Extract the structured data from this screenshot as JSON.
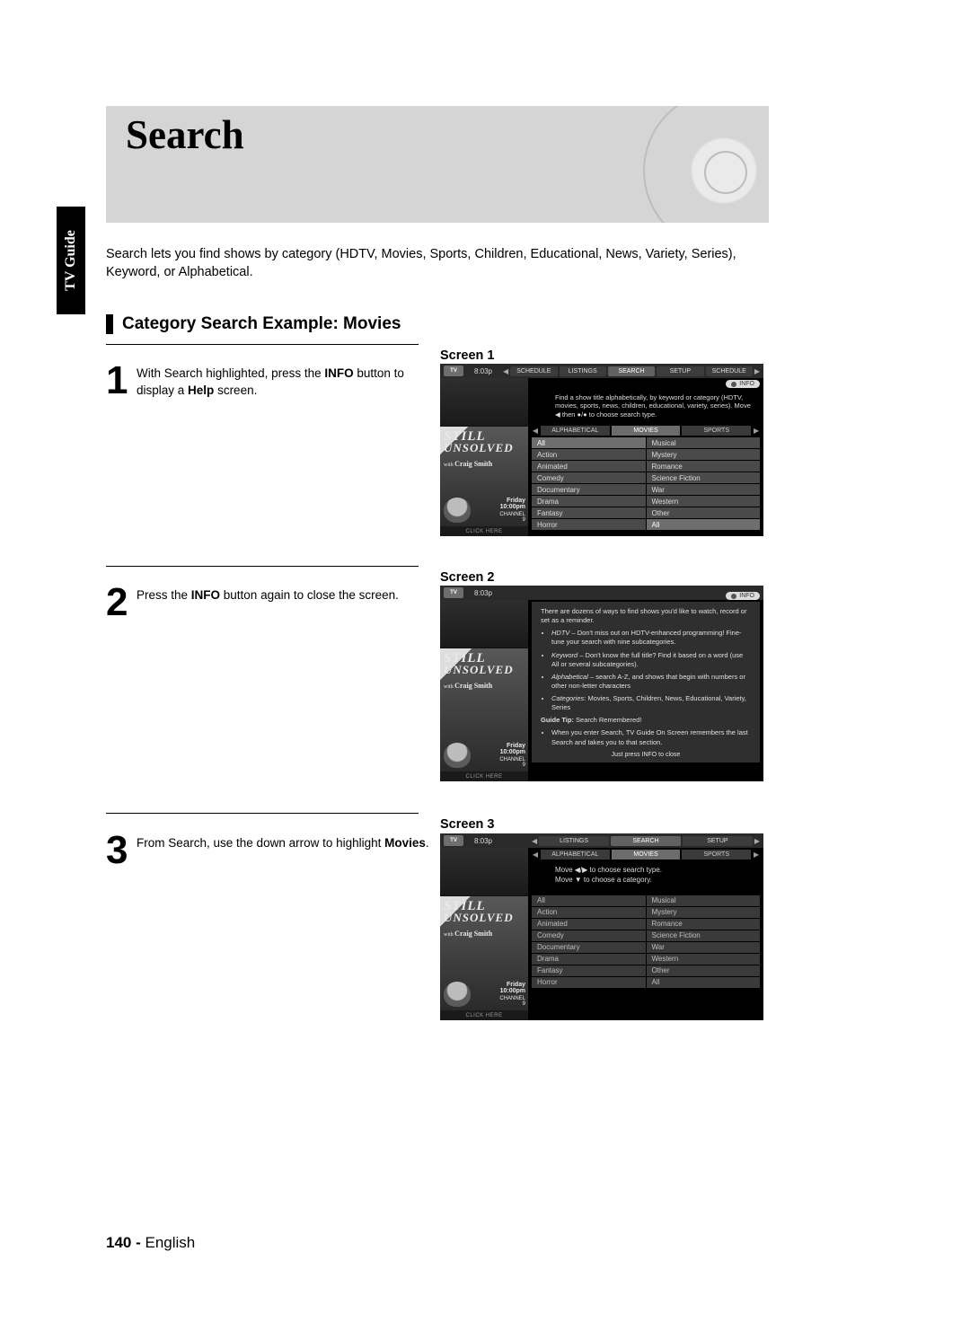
{
  "side_tab": "TV Guide",
  "banner_title": "Search",
  "intro": "Search lets you find shows by category (HDTV, Movies, Sports, Children, Educational, News, Variety, Series), Keyword, or Alphabetical.",
  "section_heading": "Category Search Example: Movies",
  "steps": {
    "s1": {
      "num": "1",
      "pre": "With Search highlighted, press the ",
      "b1": "INFO",
      "mid": " button to display a ",
      "b2": "Help",
      "post": " screen."
    },
    "s2": {
      "num": "2",
      "pre": "Press the ",
      "b1": "INFO",
      "post": " button again to close the screen."
    },
    "s3": {
      "num": "3",
      "pre": "From Search, use the down arrow to highlight ",
      "b1": "Movies",
      "post": "."
    }
  },
  "labels": {
    "screen1": "Screen 1",
    "screen2": "Screen 2",
    "screen3": "Screen 3"
  },
  "tv": {
    "logo": "TV",
    "time": "8:03p",
    "click": "CLICK HERE",
    "info_badge": "INFO",
    "poster": {
      "line1": "STILL",
      "line2": "UNSOLVED",
      "with": "with",
      "name": "Craig Smith",
      "day": "Friday",
      "timeslot": "10:00pm",
      "ch_label": "CHANNEL",
      "ch": "9"
    },
    "menu": {
      "items": [
        "SCHEDULE",
        "LISTINGS",
        "SEARCH",
        "SETUP",
        "SCHEDULE"
      ],
      "items3": [
        "LISTINGS",
        "SEARCH",
        "SETUP"
      ]
    },
    "help_text": "Find a show title alphabetically, by keyword or category (HDTV, movies, sports, news, children, educational, variety, series). Move ◀ then ●/● to choose search type.",
    "subtabs": [
      "ALPHABETICAL",
      "MOVIES",
      "SPORTS"
    ],
    "categories_left": [
      "All",
      "Action",
      "Animated",
      "Comedy",
      "Documentary",
      "Drama",
      "Fantasy",
      "Horror"
    ],
    "categories_right": [
      "Musical",
      "Mystery",
      "Romance",
      "Science Fiction",
      "War",
      "Western",
      "Other",
      "All"
    ],
    "help2": {
      "lead": "There are dozens of ways to find shows you'd like to watch, record or set as a reminder.",
      "b1": {
        "em": "HDTV",
        "rest": " – Don't miss out on HDTV-enhanced programming! Fine-tune your search with nine subcategories."
      },
      "b2": {
        "em": "Keyword",
        "rest": " – Don't know the full title? Find it based on a word (use All or several subcategories)."
      },
      "b3": {
        "em": "Alphabetical",
        "rest": " – search A-Z, and shows that begin with numbers or other non-letter characters"
      },
      "b4": {
        "em": "Categories",
        "rest": ": Movies, Sports, Children, News, Educational, Variety, Series"
      },
      "tip_head": "Guide Tip:",
      "tip_rest": " Search Remembered!",
      "tip_body": "When you enter Search, TV Guide On Screen remembers the last Search and takes you to that section.",
      "close": "Just press INFO to close"
    },
    "hints": {
      "l1": "Move ◀/▶ to choose search type.",
      "l2": "Move ▼ to choose a category."
    }
  },
  "footer": {
    "page": "140 -",
    "lang": "English"
  }
}
